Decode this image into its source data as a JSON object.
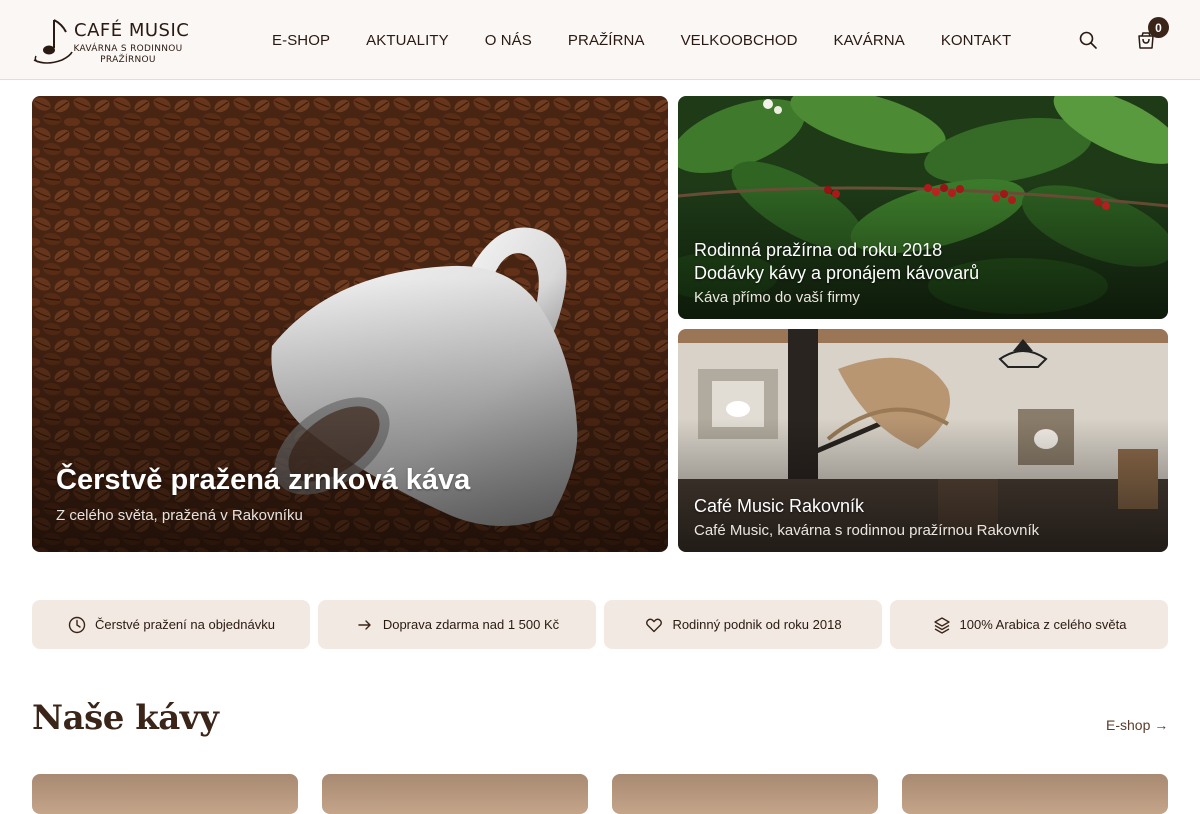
{
  "header": {
    "brand_title": "CAFÉ MUSIC",
    "brand_sub_1": "KAVÁRNA S RODINNOU",
    "brand_sub_2": "PRAŽÍRNOU",
    "nav": [
      "E-SHOP",
      "AKTUALITY",
      "O NÁS",
      "PRAŽÍRNA",
      "VELKOOBCHOD",
      "KAVÁRNA",
      "KONTAKT"
    ],
    "cart_count": "0"
  },
  "hero": {
    "main": {
      "title": "Čerstvě pražená zrnková káva",
      "subtitle": "Z celého světa, pražená v Rakovníku"
    },
    "plant": {
      "title_1": "Rodinná pražírna od roku 2018",
      "title_2": "Dodávky kávy a pronájem kávovarů",
      "subtitle": "Káva přímo do vaší firmy"
    },
    "cafe": {
      "title": "Café Music Rakovník",
      "subtitle": "Café Music, kavárna s rodinnou pražírnou Rakovník"
    }
  },
  "features": [
    {
      "icon": "clock-icon",
      "label": "Čerstvé pražení na objednávku"
    },
    {
      "icon": "arrow-right-icon",
      "label": "Doprava zdarma nad 1 500 Kč"
    },
    {
      "icon": "heart-icon",
      "label": "Rodinný podnik od roku 2018"
    },
    {
      "icon": "layers-icon",
      "label": "100% Arabica z celého světa"
    }
  ],
  "section": {
    "title": "Naše kávy",
    "link": "E-shop →"
  },
  "colors": {
    "brand_brown": "#3b2418",
    "feature_bg": "#f2e9e2",
    "header_bg": "#faf7f4"
  }
}
